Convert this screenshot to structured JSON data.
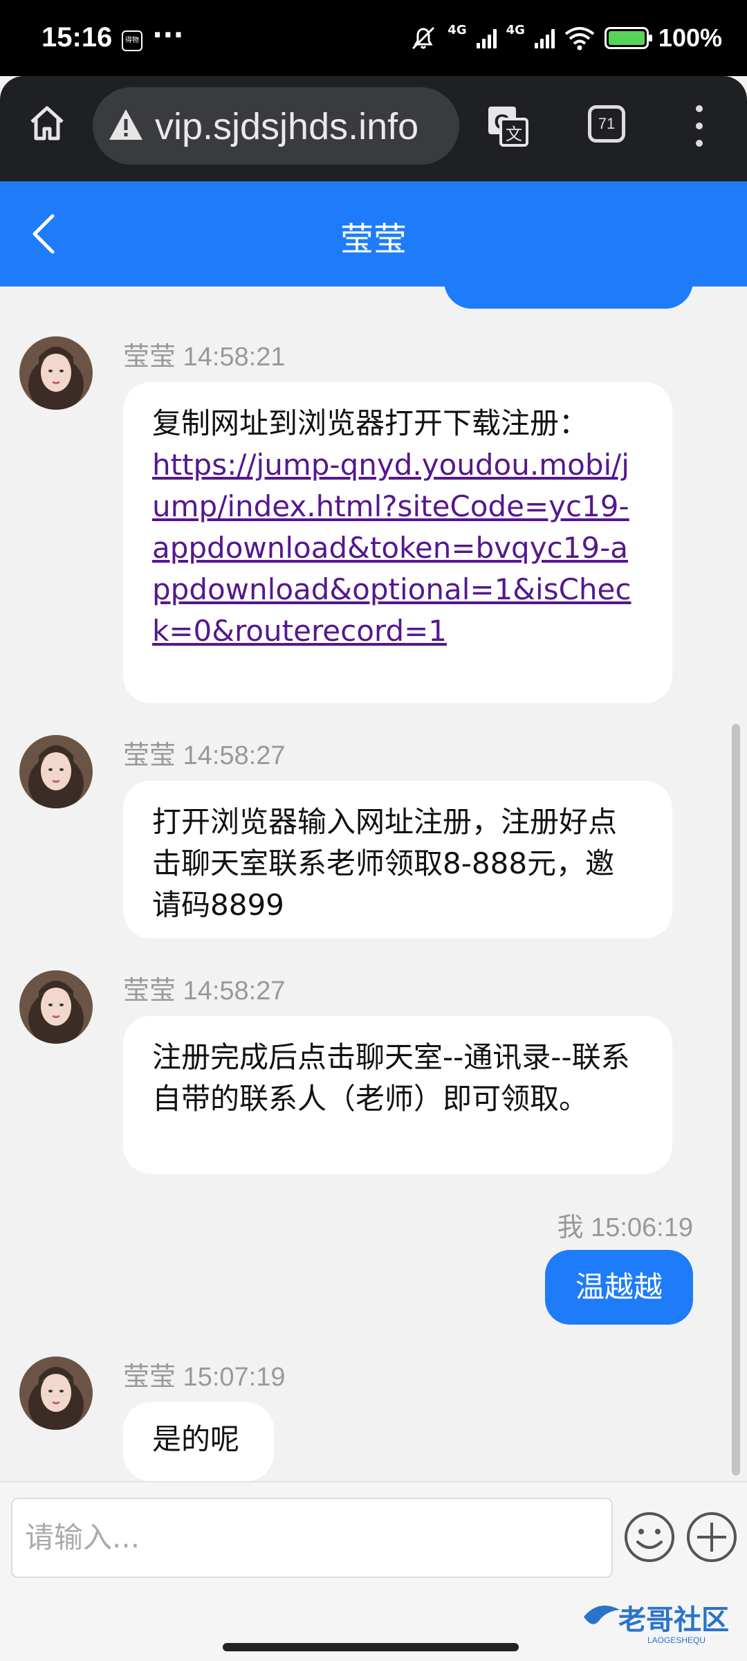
{
  "status_bar": {
    "time": "15:16",
    "app_icon_label": "得物",
    "dots": "···",
    "network_1": "4G",
    "network_2": "4G",
    "battery_percent": "100%"
  },
  "browser": {
    "url": "vip.sjdsjhds.info",
    "tab_count": "71"
  },
  "chat": {
    "title": "莹莹",
    "messages": [
      {
        "sender_time": "莹莹 14:58:21",
        "text_prefix": "复制网址到浏览器打开下载注册：",
        "link": "https://jump-qnyd.youdou.mobi/jump/index.html?siteCode=yc19-appdownload&token=bvqyc19-appdownload&optional=1&isCheck=0&routerecord=1"
      },
      {
        "sender_time": "莹莹 14:58:27",
        "text": "打开浏览器输入网址注册，注册好点击聊天室联系老师领取8-888元，邀请码8899"
      },
      {
        "sender_time": "莹莹 14:58:27",
        "text": "注册完成后点击聊天室--通讯录--联系自带的联系人（老师）即可领取。"
      },
      {
        "sender_time": "我 15:06:19",
        "text": "温越越"
      },
      {
        "sender_time": "莹莹 15:07:19",
        "text": "是的呢"
      }
    ]
  },
  "input": {
    "placeholder": "请输入..."
  },
  "watermark": {
    "text": "老哥社区",
    "subtext": "LAOGESHEQU"
  }
}
